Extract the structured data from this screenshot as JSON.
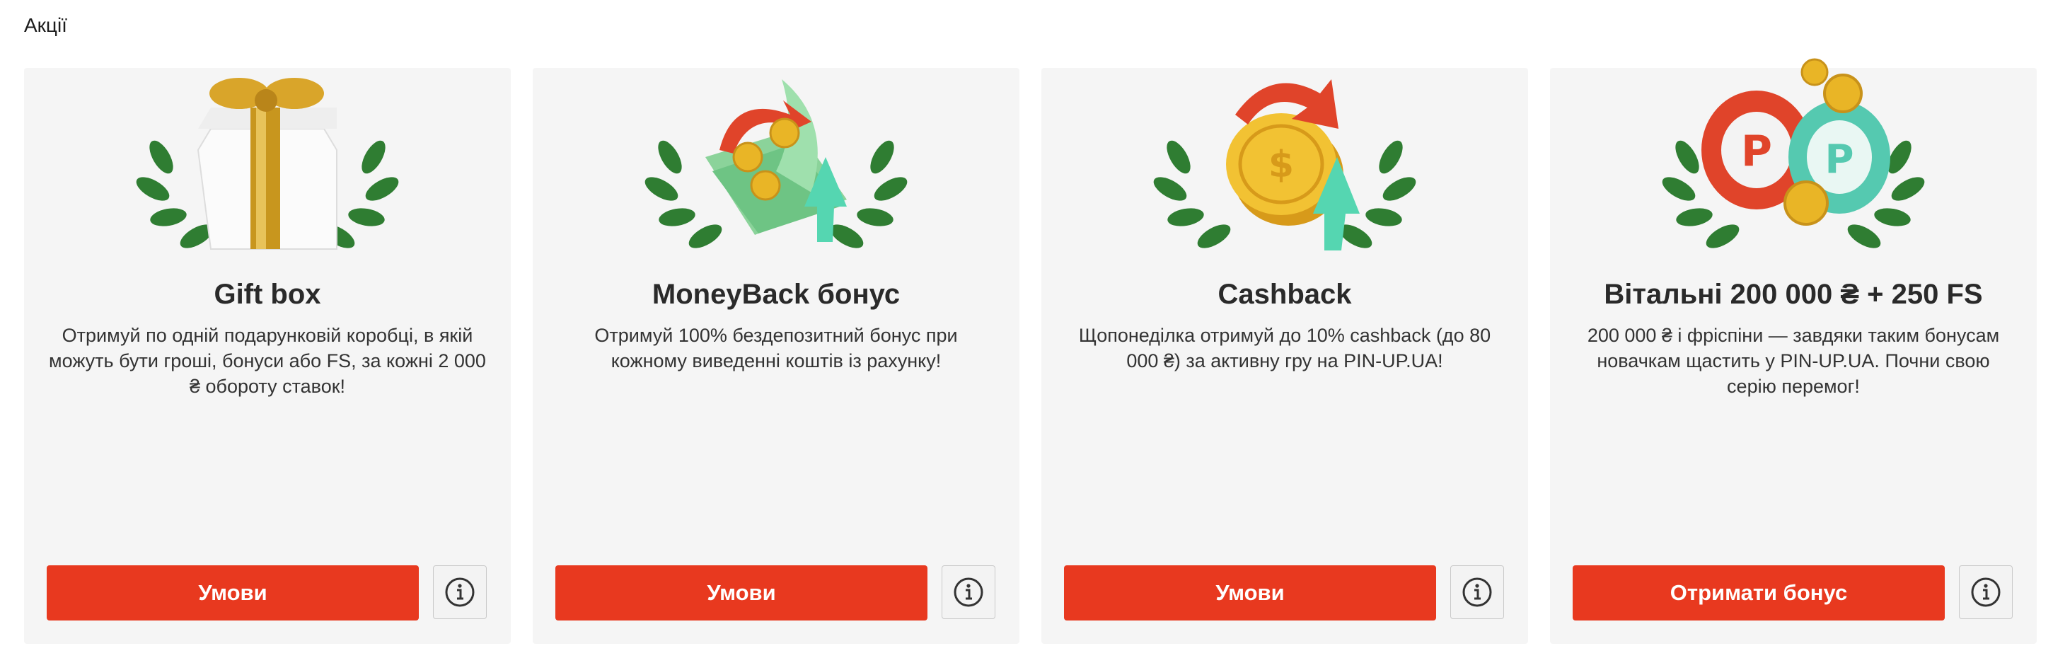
{
  "section": {
    "title": "Акції"
  },
  "promos": [
    {
      "title": "Gift box",
      "description": "Отримуй по одній подарунковій коробці, в якій можуть бути гроші, бонуси або FS, за кожні 2 000 ₴ обороту ставок!",
      "button_label": "Умови",
      "illustration": "gift-box"
    },
    {
      "title": "MoneyBack бонус",
      "description": "Отримуй 100% бездепозитний бонус при кожному виведенні коштів із рахунку!",
      "button_label": "Умови",
      "illustration": "money-stack"
    },
    {
      "title": "Cashback",
      "description": "Щопонеділка отримуй до 10% cashback (до 80 000 ₴) за активну гру на PIN-UP.UA!",
      "button_label": "Умови",
      "illustration": "gold-coin-arrows"
    },
    {
      "title": "Вітальні 200 000 ₴ + 250 FS",
      "description": "200 000 ₴ і фріспіни — завдяки таким бонусам новачкам щастить у PIN-UP.UA. Почни свою серію перемог!",
      "button_label": "Отримати бонус",
      "illustration": "casino-chips"
    }
  ],
  "colors": {
    "accent": "#e8391f",
    "card_background": "#f5f5f5",
    "laurel": "#2f7d32",
    "gold": "#e9b526"
  }
}
